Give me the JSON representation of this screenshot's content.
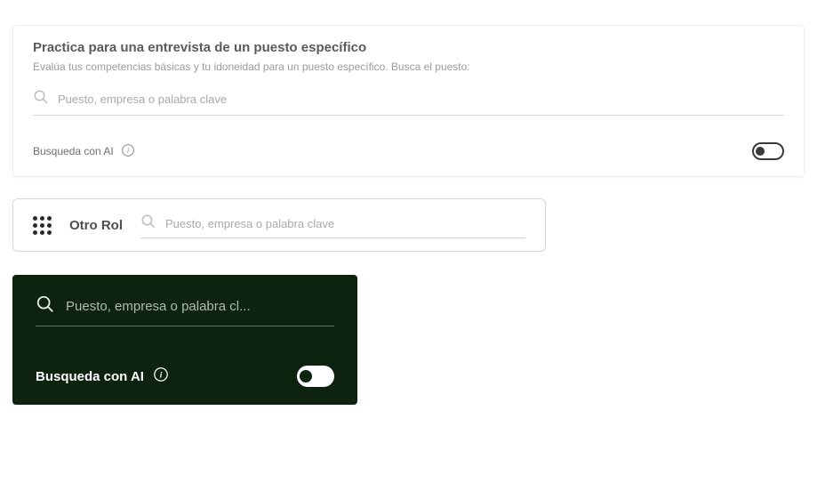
{
  "section1": {
    "title": "",
    "panel_title": "Practica para una entrevista de un puesto específico",
    "panel_subtitle": "Evalúa tus competencias básicas y tu idoneidad para un puesto específico. Busca el puesto:",
    "search_placeholder": "Puesto, empresa o palabra clave",
    "ai_label": "Busqueda con AI",
    "toggle_state": "off"
  },
  "section2": {
    "title": "",
    "chip_label": "Otro Rol",
    "search_placeholder": "Puesto, empresa o palabra clave"
  },
  "section3": {
    "title": "",
    "search_placeholder": "Puesto, empresa o palabra cl...",
    "ai_label": "Busqueda con AI",
    "toggle_state": "off"
  }
}
